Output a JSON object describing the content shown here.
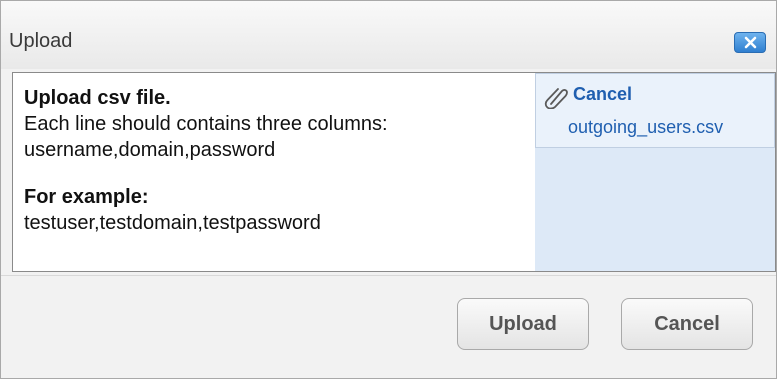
{
  "dialog": {
    "title": "Upload",
    "close_icon": "close-icon"
  },
  "instructions": {
    "heading": "Upload csv file.",
    "line1": "Each line should contains three columns:",
    "line2": "username,domain,password",
    "example_heading": "For example:",
    "example_line": "testuser,testdomain,testpassword"
  },
  "attachment": {
    "icon": "paperclip-icon",
    "cancel_label": "Cancel",
    "file_name": "outgoing_users.csv"
  },
  "buttons": {
    "upload_label": "Upload",
    "cancel_label": "Cancel"
  },
  "colors": {
    "accent": "#2f7fd0",
    "link": "#1f5fb0",
    "attach_bg": "#dde9f7"
  }
}
